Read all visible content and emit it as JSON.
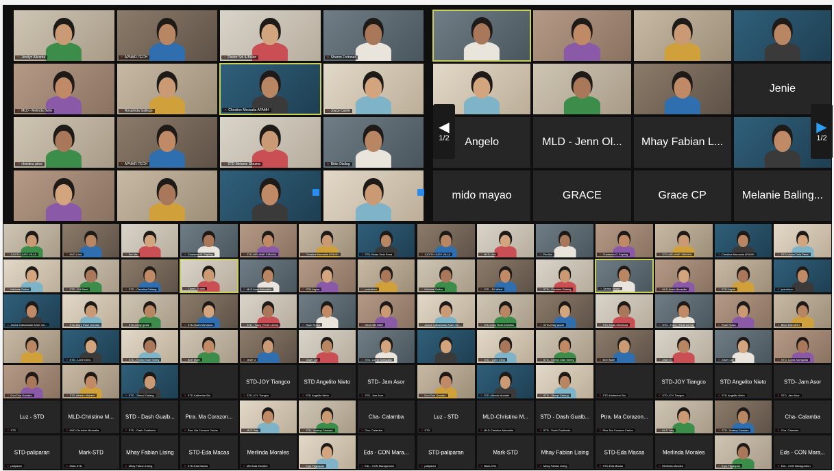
{
  "meeting": {
    "panel1": {
      "tiles": [
        {
          "name": "Jerelyn Alicante",
          "video": true
        },
        {
          "name": "APNMR-TECH",
          "video": true
        },
        {
          "name": "Pastor Sol & Belen",
          "video": true
        },
        {
          "name": "Sharon Fortunat",
          "video": true
        },
        {
          "name": "MLD - Melinda Bello",
          "video": true
        },
        {
          "name": "Rosalinda Gallego",
          "video": true
        },
        {
          "name": "Christine Meosalia AFAMH",
          "video": true,
          "highlight": true
        },
        {
          "name": "Joyce Carrie",
          "video": true
        },
        {
          "name": "christina pitos",
          "video": true
        },
        {
          "name": "APNMR-TECH",
          "video": true
        },
        {
          "name": "STD-Melanie Sibuma",
          "video": true
        },
        {
          "name": "Bittie Diallag",
          "video": true
        },
        {
          "name": "",
          "video": true
        },
        {
          "name": "",
          "video": true
        },
        {
          "name": "",
          "video": true
        },
        {
          "name": "",
          "video": true
        }
      ]
    },
    "panel2": {
      "page_left": "1/2",
      "page_right": "1/2",
      "tiles": [
        {
          "name": "",
          "video": true,
          "highlight": true
        },
        {
          "name": "",
          "video": true
        },
        {
          "name": "",
          "video": true
        },
        {
          "name": "",
          "video": true
        },
        {
          "name": "",
          "video": true
        },
        {
          "name": "",
          "video": true
        },
        {
          "name": "",
          "video": true
        },
        {
          "name": "Jenie",
          "video": false
        },
        {
          "name": "Angelo",
          "video": false
        },
        {
          "name": "MLD - Jenn Ol...",
          "video": false
        },
        {
          "name": "Mhay Fabian L...",
          "video": false
        },
        {
          "name": "",
          "video": true
        },
        {
          "name": "mido mayao",
          "video": false
        },
        {
          "name": "GRACE",
          "video": false
        },
        {
          "name": "Grace CP",
          "video": false
        },
        {
          "name": "Melanie Baling...",
          "video": false
        }
      ]
    },
    "bottom_half": {
      "rows": [
        [
          {
            "name": "JUDITH JUDY VILLA",
            "video": true
          },
          {
            "name": "MLD-Lbol",
            "video": true
          },
          {
            "name": "Per Ma",
            "video": true
          },
          {
            "name": "Charisma G. Fapiing",
            "video": true
          },
          {
            "name": "STD-MELANIE SIBUMA",
            "video": true
          },
          {
            "name": "Christine Meosalia AFAMH",
            "video": true
          },
          {
            "name": "STD-Vivian Dela Pena",
            "video": true
          }
        ],
        [
          {
            "name": "Melinda Galino",
            "video": true
          },
          {
            "name": "STD - Ed Ward",
            "video": true
          },
          {
            "name": "STD - Carmina Galang",
            "video": true
          },
          {
            "name": "Duma, Susan",
            "video": true,
            "highlight": true
          },
          {
            "name": "MLD Arwa Meosalia",
            "video": true
          },
          {
            "name": "STD-Jayne",
            "video": true
          },
          {
            "name": "prarminco",
            "video": true
          }
        ],
        [
          {
            "name": "Janice Cabactulan Ande me...",
            "video": true
          },
          {
            "name": "STD-Mary Rose Dondao",
            "video": true
          },
          {
            "name": "STD-mhay gozar",
            "video": true
          },
          {
            "name": "STD-Noah Mendoza",
            "video": true
          },
          {
            "name": "STD - Tracy (Trinie Lema)",
            "video": true
          },
          {
            "name": "Ryan Ruiza",
            "video": true
          },
          {
            "name": "Blind Milli MNH",
            "video": true
          }
        ],
        [
          {
            "name": "",
            "video": true
          },
          {
            "name": "STD - Lorie Gimo",
            "video": true
          },
          {
            "name": "STD - Kimlyn Mae Simby",
            "video": true
          },
          {
            "name": "Bnel Mael",
            "video": true
          },
          {
            "name": "Jesie G",
            "video": true
          },
          {
            "name": "Gisler Lily",
            "video": true
          },
          {
            "name": "STD- Lorna Somguilla",
            "video": true
          }
        ],
        [
          {
            "name": "Don Don Ganado",
            "video": true
          },
          {
            "name": "STD-Alfredo Mukalel",
            "video": true
          },
          {
            "name": "STD - Sheryl Galang",
            "video": true
          },
          {
            "name": "STD-Katherine Bio",
            "video": false,
            "big": ""
          },
          {
            "name": "STD-JOY Tiangco",
            "video": false,
            "big": "STD-JOY Tiangco"
          },
          {
            "name": "STD Angelito Nieto",
            "video": false,
            "big": "STD Angelito Nieto"
          },
          {
            "name": "STD- Jam Asor",
            "video": false,
            "big": "STD- Jam Asor"
          }
        ],
        [
          {
            "name": "STD",
            "video": false,
            "big": "Luz - STD"
          },
          {
            "name": "MLD-Christine Meosalia",
            "video": false,
            "big": "MLD-Christine M..."
          },
          {
            "name": "STD - Dash Gualberto",
            "video": false,
            "big": "STD - Dash Gualb..."
          },
          {
            "name": "Ptra. Ma Corazon Carlos",
            "video": false,
            "big": "Ptra. Ma Corazon..."
          },
          {
            "name": "MLD Vaty",
            "video": true
          },
          {
            "name": "STD- Jeramy Camaso",
            "video": true
          },
          {
            "name": "Cha- Calamba",
            "video": false,
            "big": "Cha- Calamba"
          }
        ],
        [
          {
            "name": "paliparan",
            "video": false,
            "big": "STD-paliparan"
          },
          {
            "name": "Mark-STD",
            "video": false,
            "big": "Mark-STD"
          },
          {
            "name": "Mhay Fabian Lising",
            "video": false,
            "big": "Mhay Fabian Lising"
          },
          {
            "name": "STD-Eda Macas",
            "video": false,
            "big": "STD-Eda Macas"
          },
          {
            "name": "Merlinda Morales",
            "video": false,
            "big": "Merlinda Morales"
          },
          {
            "name": "Krys Pagaspas",
            "video": true
          },
          {
            "name": "Eds - CON Maragondon",
            "video": false,
            "big": "Eds - CON Mara..."
          }
        ]
      ]
    }
  }
}
